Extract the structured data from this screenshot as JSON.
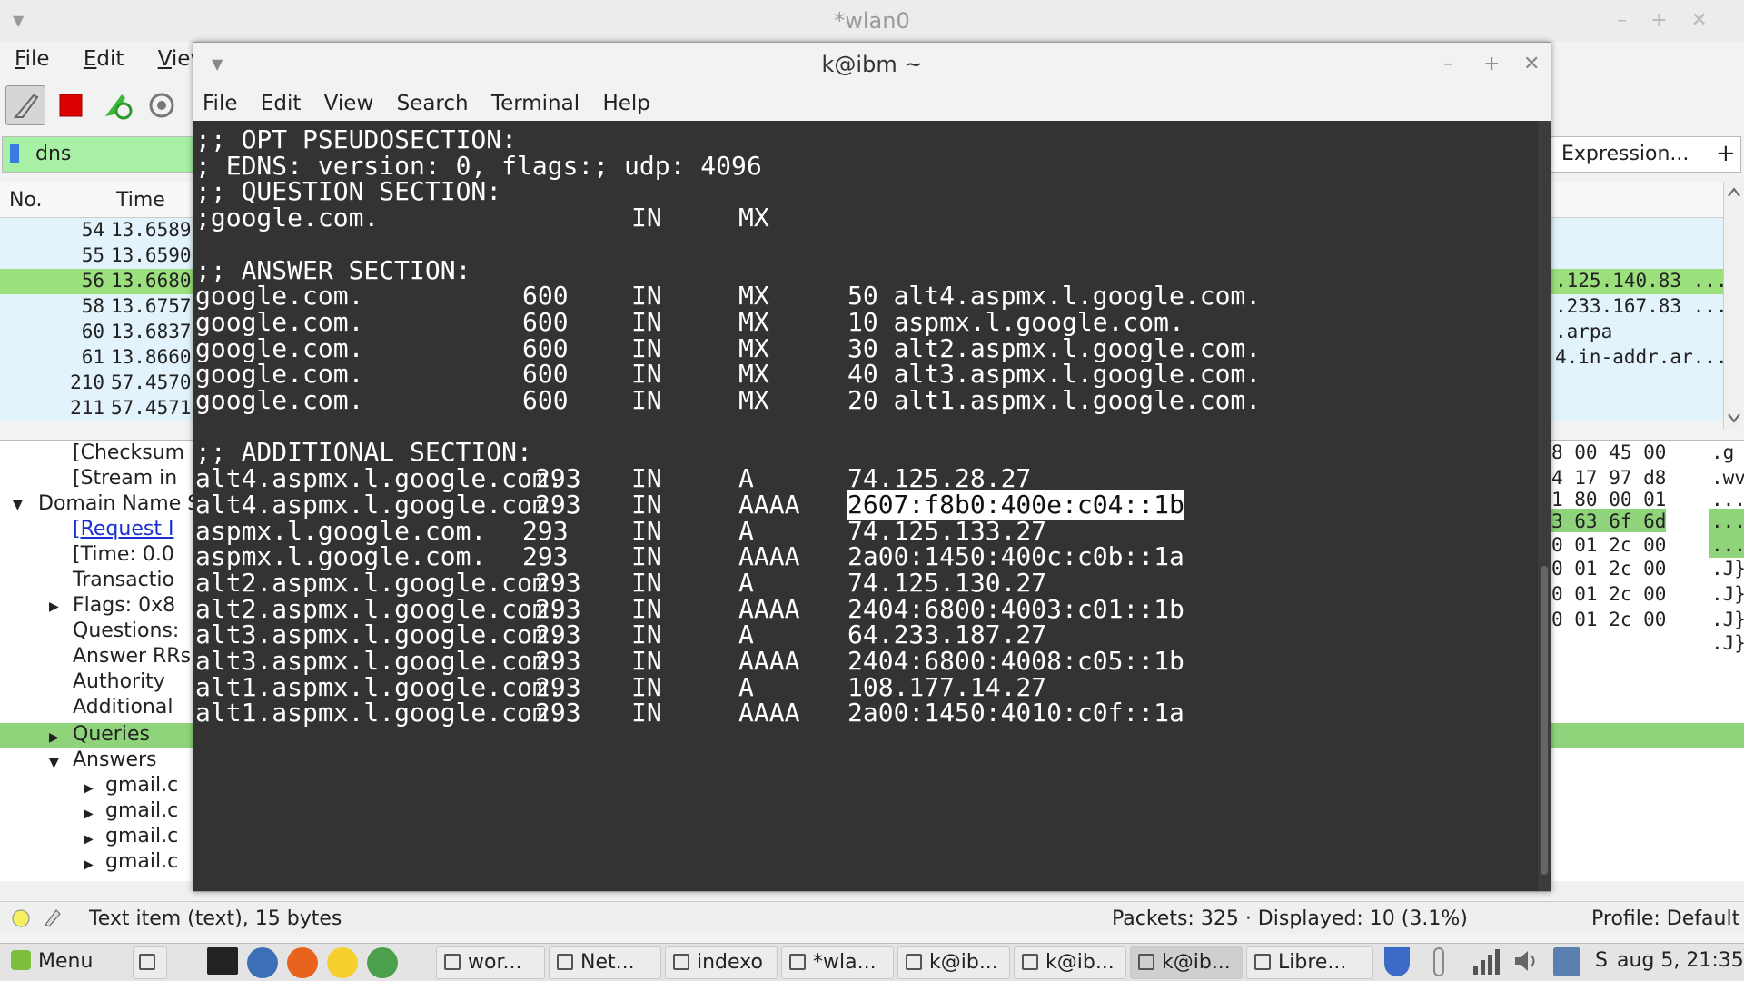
{
  "wireshark": {
    "title": "*wlan0",
    "menu": [
      "File",
      "Edit",
      "View"
    ],
    "filter_value": "dns",
    "expression_label": "Expression...",
    "plus_label": "+",
    "columns": [
      "No.",
      "Time"
    ],
    "packets": [
      {
        "no": "54",
        "time": "13.6589",
        "info": ""
      },
      {
        "no": "55",
        "time": "13.6590",
        "info": ""
      },
      {
        "no": "56",
        "time": "13.6680",
        "info": ".125.140.83 ..."
      },
      {
        "no": "58",
        "time": "13.6757",
        "info": ".233.167.83 ..."
      },
      {
        "no": "60",
        "time": "13.6837",
        "info": ".arpa"
      },
      {
        "no": "61",
        "time": "13.8660",
        "info": "4.in-addr.ar..."
      },
      {
        "no": "210",
        "time": "57.4570",
        "info": ""
      },
      {
        "no": "211",
        "time": "57.4571",
        "info": ""
      }
    ],
    "detail_lines": [
      {
        "text": "[Checksum",
        "indent": 1,
        "link": false,
        "tri": ""
      },
      {
        "text": "[Stream in",
        "indent": 1,
        "link": false,
        "tri": ""
      },
      {
        "text": "Domain Name S",
        "indent": 0,
        "link": false,
        "tri": "▼"
      },
      {
        "text": "[Request I",
        "indent": 1,
        "link": true,
        "tri": ""
      },
      {
        "text": "[Time: 0.0",
        "indent": 1,
        "link": false,
        "tri": ""
      },
      {
        "text": "Transactio",
        "indent": 1,
        "link": false,
        "tri": ""
      },
      {
        "text": "Flags: 0x8",
        "indent": 1,
        "link": false,
        "tri": "▶"
      },
      {
        "text": "Questions:",
        "indent": 1,
        "link": false,
        "tri": ""
      },
      {
        "text": "Answer RRs",
        "indent": 1,
        "link": false,
        "tri": ""
      },
      {
        "text": "Authority",
        "indent": 1,
        "link": false,
        "tri": ""
      },
      {
        "text": "Additional",
        "indent": 1,
        "link": false,
        "tri": ""
      },
      {
        "text": "Queries",
        "indent": 1,
        "link": false,
        "tri": "▶"
      },
      {
        "text": "Answers",
        "indent": 1,
        "link": false,
        "tri": "▼"
      },
      {
        "text": "gmail.c",
        "indent": 2,
        "link": false,
        "tri": "▶"
      },
      {
        "text": "gmail.c",
        "indent": 2,
        "link": false,
        "tri": "▶"
      },
      {
        "text": "gmail.c",
        "indent": 2,
        "link": false,
        "tri": "▶"
      },
      {
        "text": "gmail.c",
        "indent": 2,
        "link": false,
        "tri": "▶"
      }
    ],
    "hex_lines": [
      {
        "hex": "8 00 45 00",
        "ascii": ".g"
      },
      {
        "hex": "4 17 97 d8",
        "ascii": ".wv"
      },
      {
        "hex": "1 80 00 01",
        "ascii": "..."
      },
      {
        "hex": "3 63 6f 6d",
        "ascii": "..."
      },
      {
        "hex": "0 01 2c 00",
        "ascii": "..."
      },
      {
        "hex": "0 01 2c 00",
        "ascii": ".J}"
      },
      {
        "hex": "0 01 2c 00",
        "ascii": ".J}"
      },
      {
        "hex": "0 01 2c 00",
        "ascii": ".J}"
      },
      {
        "hex": "",
        "ascii": ".J}"
      }
    ],
    "status": {
      "left": "Text item (text), 15 bytes",
      "packets": "Packets: 325 · Displayed: 10 (3.1%)",
      "profile": "Profile: Default"
    }
  },
  "terminal": {
    "title": "k@ibm ~",
    "menu": [
      "File",
      "Edit",
      "View",
      "Search",
      "Terminal",
      "Help"
    ],
    "lines": [
      {
        "name": ";; OPT PSEUDOSECTION:"
      },
      {
        "name": "; EDNS: version: 0, flags:; udp: 4096"
      },
      {
        "name": ";; QUESTION SECTION:"
      },
      {
        "name": ";google.com.",
        "cls": "IN",
        "type": "MX"
      },
      {
        "name": ""
      },
      {
        "name": ";; ANSWER SECTION:"
      },
      {
        "name": "google.com.",
        "ttl": "600",
        "cls": "IN",
        "type": "MX",
        "data": "50 alt4.aspmx.l.google.com."
      },
      {
        "name": "google.com.",
        "ttl": "600",
        "cls": "IN",
        "type": "MX",
        "data": "10 aspmx.l.google.com."
      },
      {
        "name": "google.com.",
        "ttl": "600",
        "cls": "IN",
        "type": "MX",
        "data": "30 alt2.aspmx.l.google.com."
      },
      {
        "name": "google.com.",
        "ttl": "600",
        "cls": "IN",
        "type": "MX",
        "data": "40 alt3.aspmx.l.google.com."
      },
      {
        "name": "google.com.",
        "ttl": "600",
        "cls": "IN",
        "type": "MX",
        "data": "20 alt1.aspmx.l.google.com."
      },
      {
        "name": ""
      },
      {
        "name": ";; ADDITIONAL SECTION:"
      },
      {
        "name": "alt4.aspmx.l.google.com.",
        "ttl": "293",
        "cls": "IN",
        "type": "A",
        "data": "74.125.28.27"
      },
      {
        "name": "alt4.aspmx.l.google.com.",
        "ttl": "293",
        "cls": "IN",
        "type": "AAAA",
        "data": "2607:f8b0:400e:c04::1b",
        "highlight": true
      },
      {
        "name": "aspmx.l.google.com.",
        "ttl": "293",
        "cls": "IN",
        "type": "A",
        "data": "74.125.133.27"
      },
      {
        "name": "aspmx.l.google.com.",
        "ttl": "293",
        "cls": "IN",
        "type": "AAAA",
        "data": "2a00:1450:400c:c0b::1a"
      },
      {
        "name": "alt2.aspmx.l.google.com.",
        "ttl": "293",
        "cls": "IN",
        "type": "A",
        "data": "74.125.130.27"
      },
      {
        "name": "alt2.aspmx.l.google.com.",
        "ttl": "293",
        "cls": "IN",
        "type": "AAAA",
        "data": "2404:6800:4003:c01::1b"
      },
      {
        "name": "alt3.aspmx.l.google.com.",
        "ttl": "293",
        "cls": "IN",
        "type": "A",
        "data": "64.233.187.27"
      },
      {
        "name": "alt3.aspmx.l.google.com.",
        "ttl": "293",
        "cls": "IN",
        "type": "AAAA",
        "data": "2404:6800:4008:c05::1b"
      },
      {
        "name": "alt1.aspmx.l.google.com.",
        "ttl": "293",
        "cls": "IN",
        "type": "A",
        "data": "108.177.14.27"
      },
      {
        "name": "alt1.aspmx.l.google.com.",
        "ttl": "293",
        "cls": "IN",
        "type": "AAAA",
        "data": "2a00:1450:4010:c0f::1a"
      }
    ]
  },
  "taskbar": {
    "menu_label": "Menu",
    "tasks": [
      {
        "label": "wor...",
        "icon": "folder-icon",
        "active": false
      },
      {
        "label": "Net...",
        "icon": "document-icon",
        "active": false
      },
      {
        "label": "indexo",
        "icon": "folder-icon",
        "active": false
      },
      {
        "label": "*wla...",
        "icon": "wireshark-icon",
        "active": false
      },
      {
        "label": "k@ib...",
        "icon": "terminal-icon",
        "active": false
      },
      {
        "label": "k@ib...",
        "icon": "terminal-icon",
        "active": false
      },
      {
        "label": "k@ib...",
        "icon": "terminal-icon",
        "active": true
      },
      {
        "label": "Libre...",
        "icon": "document-icon",
        "active": false
      }
    ],
    "tray_letter": "S",
    "clock": "aug 5, 21:35"
  },
  "colors": {
    "terminal_bg": "#333333",
    "selection_green": "#9ce07e",
    "filter_green": "#a7f0a5",
    "row_blue": "#e2f3fb"
  }
}
